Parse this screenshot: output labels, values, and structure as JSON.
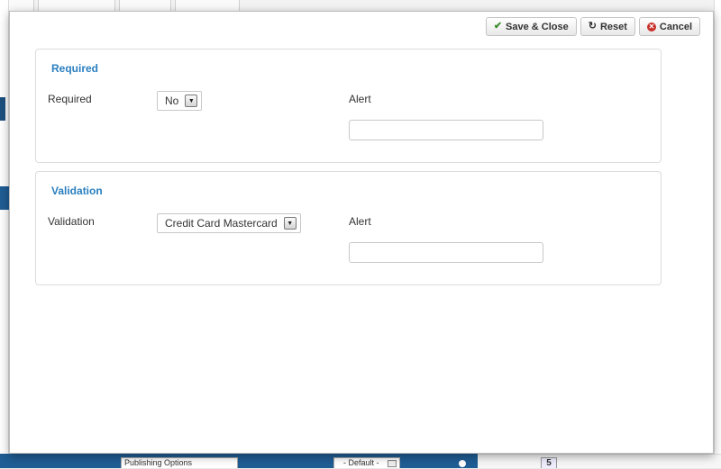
{
  "toolbar": {
    "save_close_label": "Save & Close",
    "reset_label": "Reset",
    "cancel_label": "Cancel"
  },
  "required_section": {
    "title": "Required",
    "field_label": "Required",
    "field_value": "No",
    "alert_label": "Alert",
    "alert_value": ""
  },
  "validation_section": {
    "title": "Validation",
    "field_label": "Validation",
    "field_value": "Credit Card Mastercard",
    "alert_label": "Alert",
    "alert_value": ""
  },
  "background": {
    "publishing_options": "Publishing Options",
    "default_select": "- Default -",
    "page_number": "5"
  },
  "colors": {
    "section_title": "#2a7fbf",
    "bar": "#1f5d94",
    "check": "#3d8d2f",
    "cancel": "#c8312b"
  },
  "icons": {
    "save_close": "check-icon",
    "reset": "refresh-icon",
    "cancel": "cancel-icon"
  }
}
